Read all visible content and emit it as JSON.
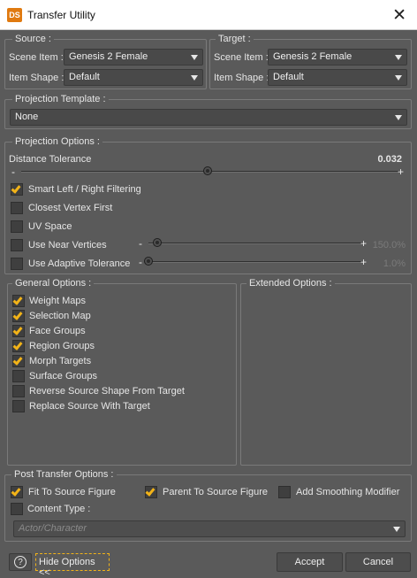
{
  "window": {
    "title": "Transfer Utility",
    "logo_text": "DS"
  },
  "source": {
    "legend": "Source :",
    "scene_item_label": "Scene Item :",
    "scene_item_value": "Genesis 2 Female",
    "item_shape_label": "Item Shape :",
    "item_shape_value": "Default"
  },
  "target": {
    "legend": "Target :",
    "scene_item_label": "Scene Item :",
    "scene_item_value": "Genesis 2 Female",
    "item_shape_label": "Item Shape :",
    "item_shape_value": "Default"
  },
  "projection_template": {
    "legend": "Projection Template :",
    "value": "None"
  },
  "projection_options": {
    "legend": "Projection Options :",
    "distance_tolerance": {
      "label": "Distance Tolerance",
      "value": "0.032",
      "level": 0.49
    },
    "smart_filtering": {
      "label": "Smart Left / Right Filtering",
      "checked": true
    },
    "closest_vertex": {
      "label": "Closest Vertex First",
      "checked": false
    },
    "uv_space": {
      "label": "UV Space",
      "checked": false
    },
    "near_vertices": {
      "label": "Use Near Vertices",
      "checked": false,
      "value": "150.0%",
      "level": 0.04
    },
    "adaptive_tolerance": {
      "label": "Use Adaptive Tolerance",
      "checked": false,
      "value": "1.0%",
      "level": 0.0
    }
  },
  "general_options": {
    "legend": "General Options :",
    "items": [
      {
        "label": "Weight Maps",
        "checked": true
      },
      {
        "label": "Selection Map",
        "checked": true
      },
      {
        "label": "Face Groups",
        "checked": true
      },
      {
        "label": "Region Groups",
        "checked": true
      },
      {
        "label": "Morph Targets",
        "checked": true
      },
      {
        "label": "Surface Groups",
        "checked": false
      },
      {
        "label": "Reverse Source Shape From Target",
        "checked": false
      },
      {
        "label": "Replace Source With Target",
        "checked": false
      }
    ]
  },
  "extended_options": {
    "legend": "Extended Options :"
  },
  "post_transfer": {
    "legend": "Post Transfer Options :",
    "fit_to_source": {
      "label": "Fit To Source Figure",
      "checked": true
    },
    "parent_to_source": {
      "label": "Parent To Source Figure",
      "checked": true
    },
    "smoothing": {
      "label": "Add Smoothing Modifier",
      "checked": false
    },
    "content_type": {
      "label": "Content Type :",
      "checked": false,
      "value": "Actor/Character"
    }
  },
  "buttons": {
    "help": "?",
    "hide_options": "Hide Options <<",
    "accept": "Accept",
    "cancel": "Cancel"
  },
  "colors": {
    "accent": "#f2b318",
    "background": "#5a5a5a",
    "titlebar": "#ffffff"
  }
}
